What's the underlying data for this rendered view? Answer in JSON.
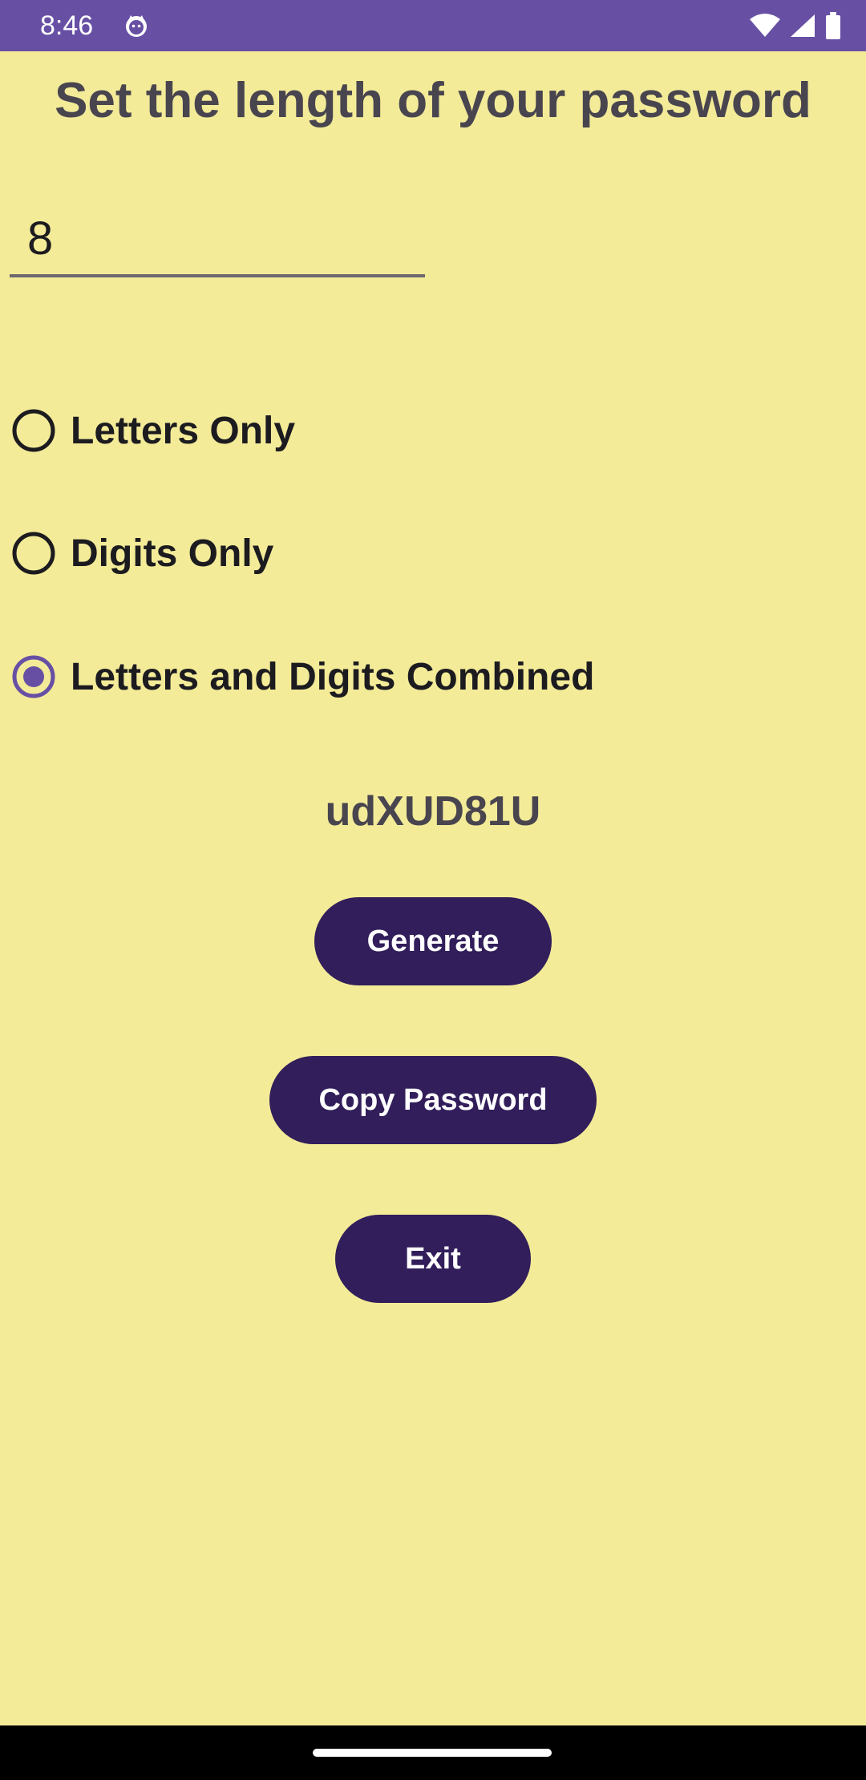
{
  "status_bar": {
    "time": "8:46",
    "icons": [
      "cat-notification-icon",
      "wifi-icon",
      "signal-icon",
      "battery-icon"
    ],
    "color": "#6750A4"
  },
  "screen": {
    "title": "Set the length of your password",
    "length_input": {
      "value": "8"
    },
    "options": [
      {
        "label": "Letters Only",
        "selected": false
      },
      {
        "label": "Digits Only",
        "selected": false
      },
      {
        "label": "Letters and Digits Combined",
        "selected": true
      }
    ],
    "generated_password": "udXUD81U",
    "buttons": {
      "generate": "Generate",
      "copy": "Copy Password",
      "exit": "Exit"
    }
  },
  "colors": {
    "background": "#F3EB98",
    "button": "#311E5A",
    "accent": "#6750A4",
    "text": "#1C1B1F"
  }
}
